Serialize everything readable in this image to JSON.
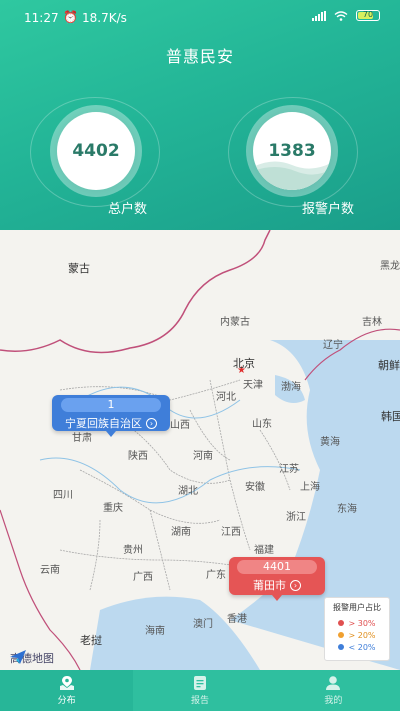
{
  "status": {
    "time": "11:27",
    "speed": "18.7K/s",
    "battery": "70"
  },
  "app": {
    "title": "普惠民安"
  },
  "stats": [
    {
      "value": "4402",
      "label": "总户数"
    },
    {
      "value": "1383",
      "label": "报警户数"
    }
  ],
  "map": {
    "labels": [
      "蒙古",
      "黑龙",
      "吉林",
      "内蒙古",
      "辽宁",
      "北京",
      "天津",
      "朝鲜",
      "渤海",
      "河北",
      "韩国",
      "山西",
      "山东",
      "黄海",
      "甘肃",
      "陕西",
      "河南",
      "江苏",
      "四川",
      "湖北",
      "安徽",
      "上海",
      "重庆",
      "浙江",
      "东海",
      "湖南",
      "江西",
      "贵州",
      "福建",
      "云南",
      "广西",
      "广东",
      "台",
      "澳门",
      "香港",
      "海南",
      "老挝"
    ],
    "provider": "高德地图"
  },
  "callouts": [
    {
      "count": "1",
      "name": "宁夏回族自治区",
      "color": "#3f7ed9"
    },
    {
      "count": "4401",
      "name": "莆田市",
      "color": "#e55555"
    }
  ],
  "legend": {
    "title": "报警用户占比",
    "items": [
      {
        "label": "> 30%",
        "color": "#e05050"
      },
      {
        "label": "> 20%",
        "color": "#f0a030"
      },
      {
        "label": "< 20%",
        "color": "#3f7ed9"
      }
    ]
  },
  "tabs": [
    {
      "label": "分布",
      "icon": "map-pin-icon",
      "active": true
    },
    {
      "label": "报告",
      "icon": "report-icon",
      "active": false
    },
    {
      "label": "我的",
      "icon": "user-icon",
      "active": false
    }
  ]
}
